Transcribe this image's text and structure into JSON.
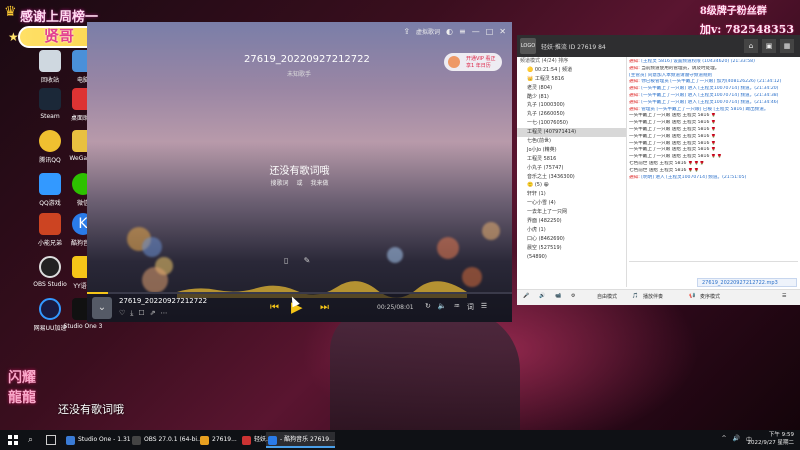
{
  "banner": {
    "thanks": "感谢上周榜一",
    "name": "贤哥",
    "fan_line1": "8级牌子粉丝群",
    "fan_line2": "加v: 782548353"
  },
  "desktop": {
    "icons": [
      "回收站",
      "电脑",
      "Steam",
      "桌面助手",
      "腾讯QQ",
      "WeGame",
      "QQ游戏",
      "微信",
      "小能兄弟",
      "酷狗音乐",
      "OBS Studio",
      "YY语音",
      "网易UU加速",
      "Studio One 3"
    ]
  },
  "player": {
    "song_title": "27619_20220927212722",
    "song_subtitle": "未知歌手",
    "promo_line1": "开通VIP 看正",
    "promo_line2": "享1 年日历",
    "header_labels": [
      "虚拟歌词"
    ],
    "lyrics_empty": "还没有歌词哦",
    "lyrics_link_search": "搜歌词",
    "lyrics_link_sep": "或",
    "lyrics_link_make": "我来做",
    "bar_title": "27619_20220927212722",
    "time": "00:25/08:01",
    "progress": 0.05,
    "accent": "#f5c518"
  },
  "chat": {
    "header_info": "轻妖·推流 ID 27619  84",
    "user_list_header": "频道模式 (4/24)  排序",
    "users": [
      "🟡 00:21:54 | 频道",
      "👑 工程灵 5816",
      "老灵 (804)",
      "酷少 (81)",
      "丸子 (1000300)",
      "丸子 (2660050)",
      "一七·(10076050)",
      "工程灵 (407971414)",
      "七色(前世)",
      "Jo小Jo (精英)",
      "工程灵 5816",
      "小丸子 (75747)",
      "音乐之土 (3436300)",
      "🙂 (5) 😀",
      "轩轩 (1)",
      "一心小雪 (4)",
      "一去年上了一只网",
      "界面 (482250)",
      "小虎 (1)",
      "口心 (8462690)",
      "晨空 (527519)",
      "(54890)"
    ],
    "messages": [
      {
        "label": "通知:",
        "text": "[王程灵 5816] 设置频道权限 (10434620)  (21:33:58)"
      },
      {
        "label": "通知:",
        "text": "当前频道使用的管理员，请及时处理。"
      },
      {
        "label": "",
        "text": "[主管员] 同意加入本频道请遵守频道规则"
      },
      {
        "label": "通知:",
        "text": "你已被管理员 [一头牛戴上了一只眼] 加为(408126226) (21:34:12)"
      },
      {
        "label": "通知:",
        "text": "[一头牛戴上了一只眼] 进入 [王程灵10070714] 频道。(21:34:20)"
      },
      {
        "label": "通知:",
        "text": "[一头牛戴上了一只眼] 进入 [王程灵10070714] 频道。(21:34:38)"
      },
      {
        "label": "通知:",
        "text": "[一头牛戴上了一只眼] 进入 [王程灵10070714] 频道。(21:34:46)"
      },
      {
        "label": "通知:",
        "text": "管理员 [一头牛戴上了一只眼] 已被 [王程灵 5816] 踢出频道。"
      },
      {
        "label": "",
        "text": "一头牛戴上了一只眼 送给 王程灵 5816 🌹"
      },
      {
        "label": "",
        "text": "一头牛戴上了一只眼 送给 王程灵 5816 🌹"
      },
      {
        "label": "",
        "text": "一头牛戴上了一只眼 送给 王程灵 5816 🌹"
      },
      {
        "label": "",
        "text": "一头牛戴上了一只眼 送给 王程灵 5816 🌹"
      },
      {
        "label": "",
        "text": "一头牛戴上了一只眼 送给 王程灵 5816 🌹"
      },
      {
        "label": "",
        "text": "一头牛戴上了一只眼 送给 王程灵 5816 🌹"
      },
      {
        "label": "",
        "text": "一头牛戴上了一只眼 送给 王程灵 5816 🌹🌹"
      },
      {
        "label": "",
        "text": "七色前世 送给 王程灵 5816 🌹🌹🌹"
      },
      {
        "label": "",
        "text": "七色前世 送给 王程灵 5816 🌹🌹"
      },
      {
        "label": "通知:",
        "text": "[明明] 进入 [王程灵10070714] 频道。(21:51:05)"
      }
    ],
    "file_chip": "27619_20220927212722.mp3",
    "bottom_buttons": [
      "🎤",
      "🔊",
      "📹",
      "⚙",
      "自由模式",
      "🎵",
      "播放伴奏",
      "📢",
      "麦序模式",
      "☰"
    ]
  },
  "overlay": {
    "logo_line1": "闪耀",
    "logo_line2": "龍龍",
    "lyrics": "还没有歌词哦"
  },
  "taskbar": {
    "search_icon": "search-icon",
    "apps": [
      {
        "label": "Studio One - 1.31",
        "color": "#3a7bd5"
      },
      {
        "label": "OBS 27.0.1 (64-bi...",
        "color": "#444"
      },
      {
        "label": "27619...",
        "color": "#e8a020"
      },
      {
        "label": "轻妖...",
        "color": "#c33"
      },
      {
        "label": "- 酷狗音乐 27619...",
        "color": "#2a7be8"
      }
    ],
    "tray": [
      "^",
      "🔊",
      "中"
    ],
    "time": "下午 9:59",
    "date": "2022/9/27 星期二"
  }
}
